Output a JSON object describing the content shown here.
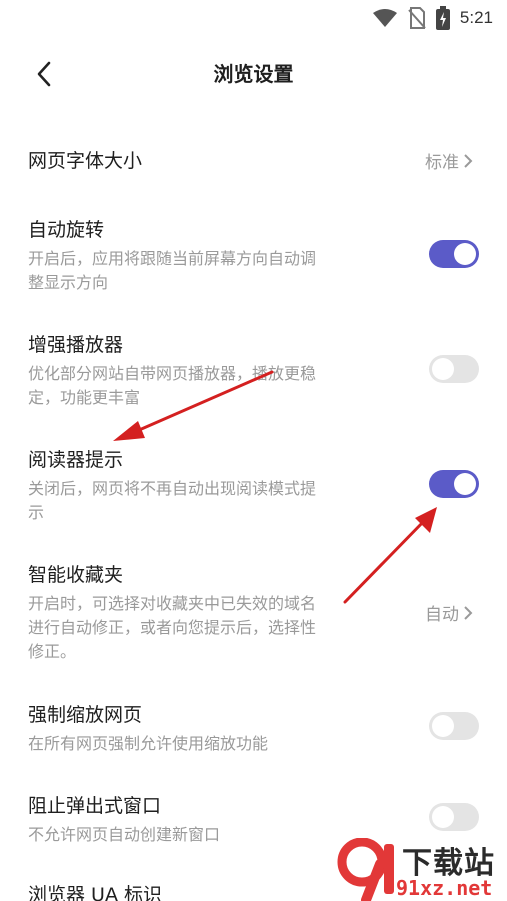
{
  "status_bar": {
    "time": "5:21",
    "icons": [
      "wifi-icon",
      "no-sim-icon",
      "battery-charging-icon"
    ]
  },
  "header": {
    "back_icon": "chevron-left-icon",
    "title": "浏览设置"
  },
  "settings": {
    "font_size": {
      "title": "网页字体大小",
      "value": "标准"
    },
    "auto_rotate": {
      "title": "自动旋转",
      "desc_line1": "开启后，应用将跟随当前屏幕方向自动调",
      "desc_line2": "整显示方向",
      "enabled": true
    },
    "enhanced_player": {
      "title": "增强播放器",
      "desc_line1": "优化部分网站自带网页播放器，播放更稳",
      "desc_line2": "定，功能更丰富",
      "enabled": false
    },
    "reader_hint": {
      "title": "阅读器提示",
      "desc_line1": "关闭后，网页将不再自动出现阅读模式提",
      "desc_line2": "示",
      "enabled": true
    },
    "smart_favorites": {
      "title": "智能收藏夹",
      "desc_line1": "开启时，可选择对收藏夹中已失效的域名",
      "desc_line2": "进行自动修正，或者向您提示后，选择性",
      "desc_line3": "修正。",
      "value": "自动"
    },
    "force_zoom": {
      "title": "强制缩放网页",
      "desc_line1": "在所有网页强制允许使用缩放功能",
      "enabled": false
    },
    "block_popups": {
      "title": "阻止弹出式窗口",
      "desc_line1": "不允许网页自动创建新窗口",
      "enabled": false
    },
    "browser_ua": {
      "title": "浏览器 UA 标识"
    }
  },
  "colors": {
    "toggle_on": "#5b5bc8",
    "toggle_off": "#e4e4e4",
    "annotation_arrow": "#d42020"
  },
  "watermark": {
    "brand": "下载站",
    "url": "91xz.net",
    "logo_glyph": "9"
  }
}
